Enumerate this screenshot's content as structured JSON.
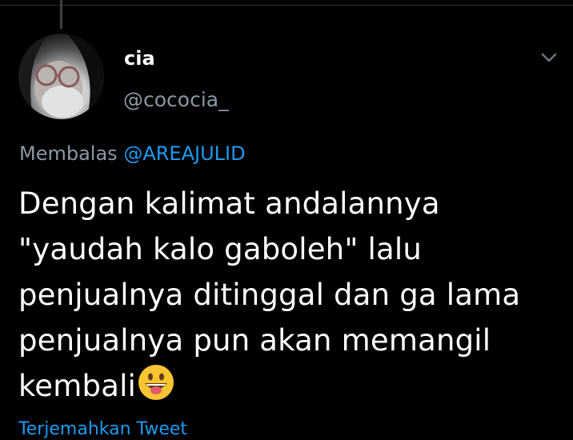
{
  "tweet": {
    "display_name": "cia",
    "handle": "@cococia_",
    "reply_prefix": "Membalas",
    "reply_mention": "@AREAJULID",
    "text_lines": [
      "Dengan kalimat andalannya",
      "\"yaudah kalo gaboleh\" lalu",
      "penjualnya ditinggal dan ga lama",
      "penjualnya pun akan memangil",
      "kembali"
    ],
    "emoji": "grinning-face-with-tongue",
    "bottom_link": "Terjemahkan Tweet"
  },
  "icons": {
    "menu": "chevron-down-icon"
  },
  "colors": {
    "background": "#000000",
    "text_primary": "#ffffff",
    "text_secondary": "#8b98a5",
    "accent": "#1d9bf0"
  }
}
